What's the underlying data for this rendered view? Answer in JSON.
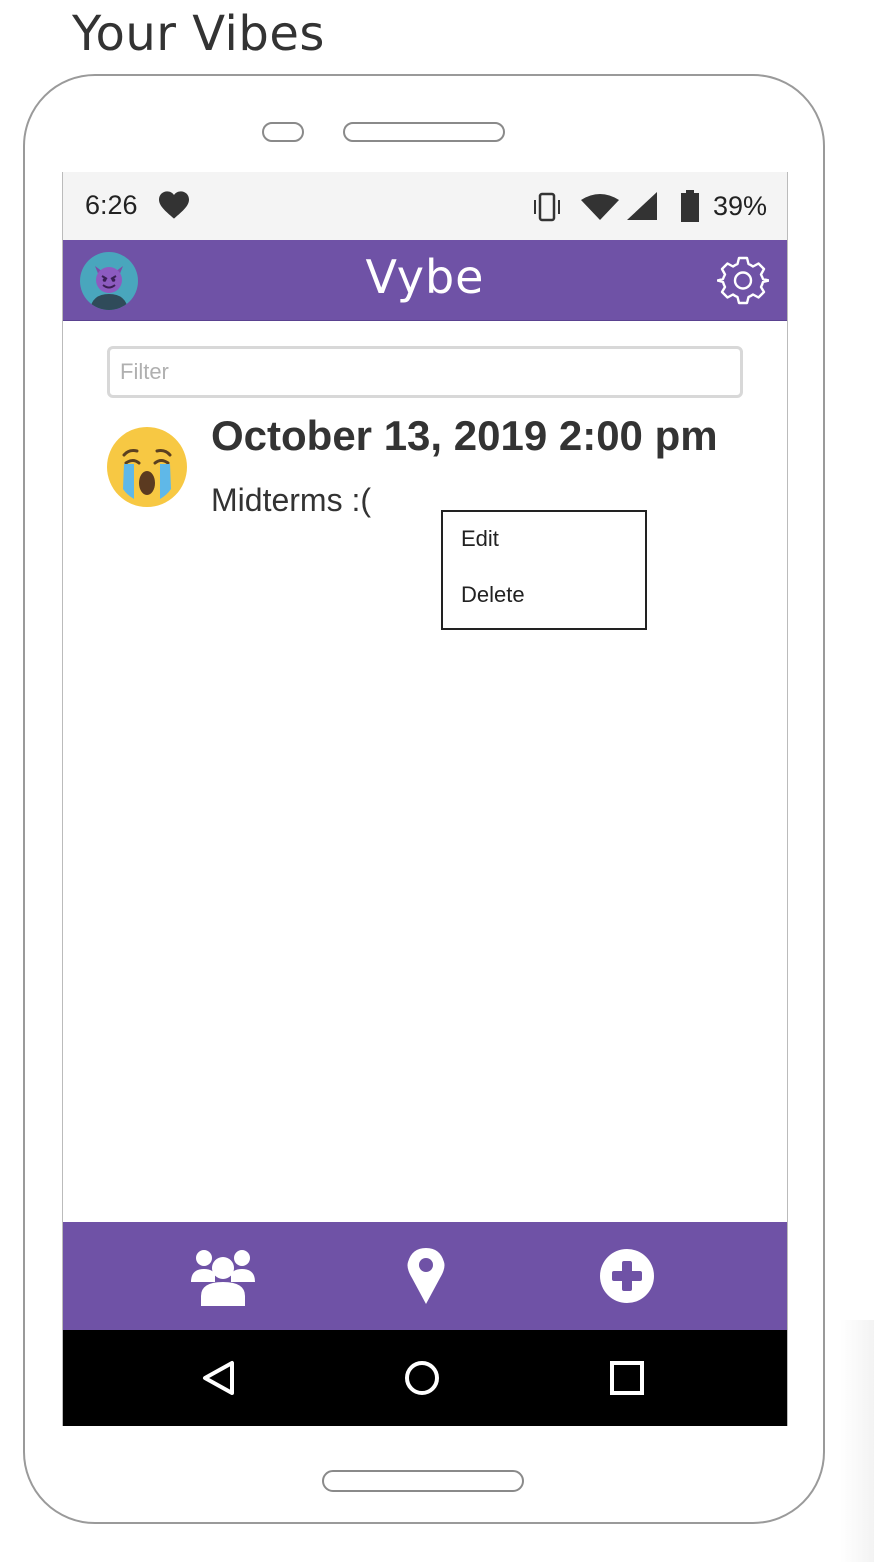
{
  "page": {
    "title": "Your Vibes"
  },
  "status_bar": {
    "time": "6:26",
    "battery_percent": "39%"
  },
  "app_bar": {
    "title": "Vybe",
    "avatar_icon": "smiling-imp-avatar",
    "settings_icon": "gear-icon"
  },
  "filter": {
    "placeholder": "Filter",
    "value": ""
  },
  "entries": [
    {
      "emoji_icon": "crying-face-icon",
      "date": "October 13, 2019 2:00 pm",
      "note": "Midterms :("
    }
  ],
  "context_menu": {
    "items": [
      "Edit",
      "Delete"
    ]
  },
  "bottom_nav": {
    "items": [
      "people-icon",
      "map-pin-icon",
      "add-icon"
    ]
  },
  "system_nav": {
    "items": [
      "back-icon",
      "home-icon",
      "recents-icon"
    ]
  },
  "colors": {
    "accent": "#6f52a6",
    "status_bar_bg": "#f4f4f4",
    "system_nav_bg": "#000000"
  }
}
